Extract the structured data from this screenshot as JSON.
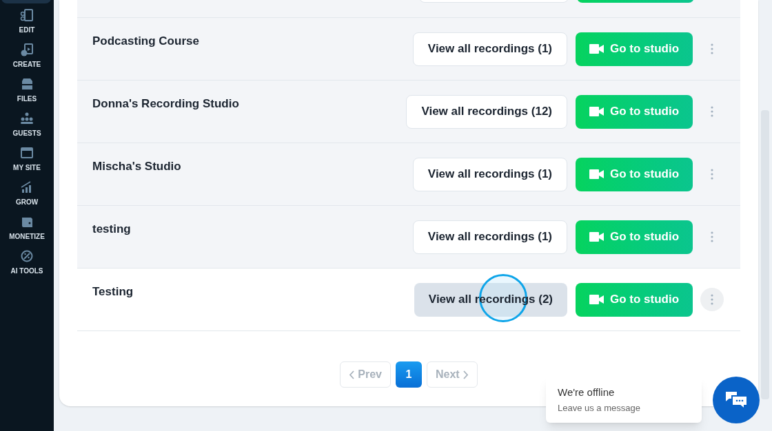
{
  "sidebar": {
    "items": [
      {
        "label": "EDIT"
      },
      {
        "label": "CREATE"
      },
      {
        "label": "FILES"
      },
      {
        "label": "GUESTS"
      },
      {
        "label": "MY SITE"
      },
      {
        "label": "GROW"
      },
      {
        "label": "MONETIZE"
      },
      {
        "label": "AI TOOLS"
      }
    ]
  },
  "studios": [
    {
      "name": "Podcasting Course",
      "view_label": "View all recordings (1)",
      "studio_label": "Go to studio",
      "hovered": false
    },
    {
      "name": "Donna's Recording Studio",
      "view_label": "View all recordings (12)",
      "studio_label": "Go to studio",
      "hovered": false
    },
    {
      "name": "Mischa's Studio",
      "view_label": "View all recordings (1)",
      "studio_label": "Go to studio",
      "hovered": false
    },
    {
      "name": "testing",
      "view_label": "View all recordings (1)",
      "studio_label": "Go to studio",
      "hovered": false
    },
    {
      "name": "Testing",
      "view_label": "View all recordings (2)",
      "studio_label": "Go to studio",
      "hovered": true
    }
  ],
  "pagination": {
    "prev": "Prev",
    "pages": [
      {
        "label": "1",
        "selected": true
      }
    ],
    "next": "Next"
  },
  "chat": {
    "title": "We're offline",
    "subtitle": "Leave us a message"
  }
}
